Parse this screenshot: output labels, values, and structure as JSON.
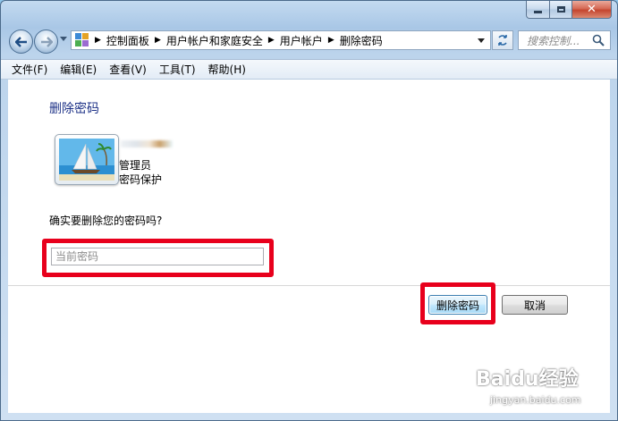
{
  "window": {
    "close_glyph": "✕"
  },
  "nav": {
    "breadcrumbs": [
      "控制面板",
      "用户帐户和家庭安全",
      "用户帐户",
      "删除密码"
    ],
    "search_placeholder": "搜索控制..."
  },
  "menu": {
    "items": [
      "文件(F)",
      "编辑(E)",
      "查看(V)",
      "工具(T)",
      "帮助(H)"
    ]
  },
  "content": {
    "title": "删除密码",
    "user": {
      "role": "管理员",
      "protection": "密码保护"
    },
    "question": "确实要删除您的密码吗?",
    "password_placeholder": "当前密码",
    "password_value": "",
    "buttons": {
      "delete": "删除密码",
      "cancel": "取消"
    },
    "highlight_color": "#e8001c"
  },
  "watermark": {
    "brand": "Baidu经验",
    "url": "jingyan.baidu.com"
  },
  "colors": {
    "title_blue": "#1e3287",
    "window_frame": "#a9c7e6"
  }
}
